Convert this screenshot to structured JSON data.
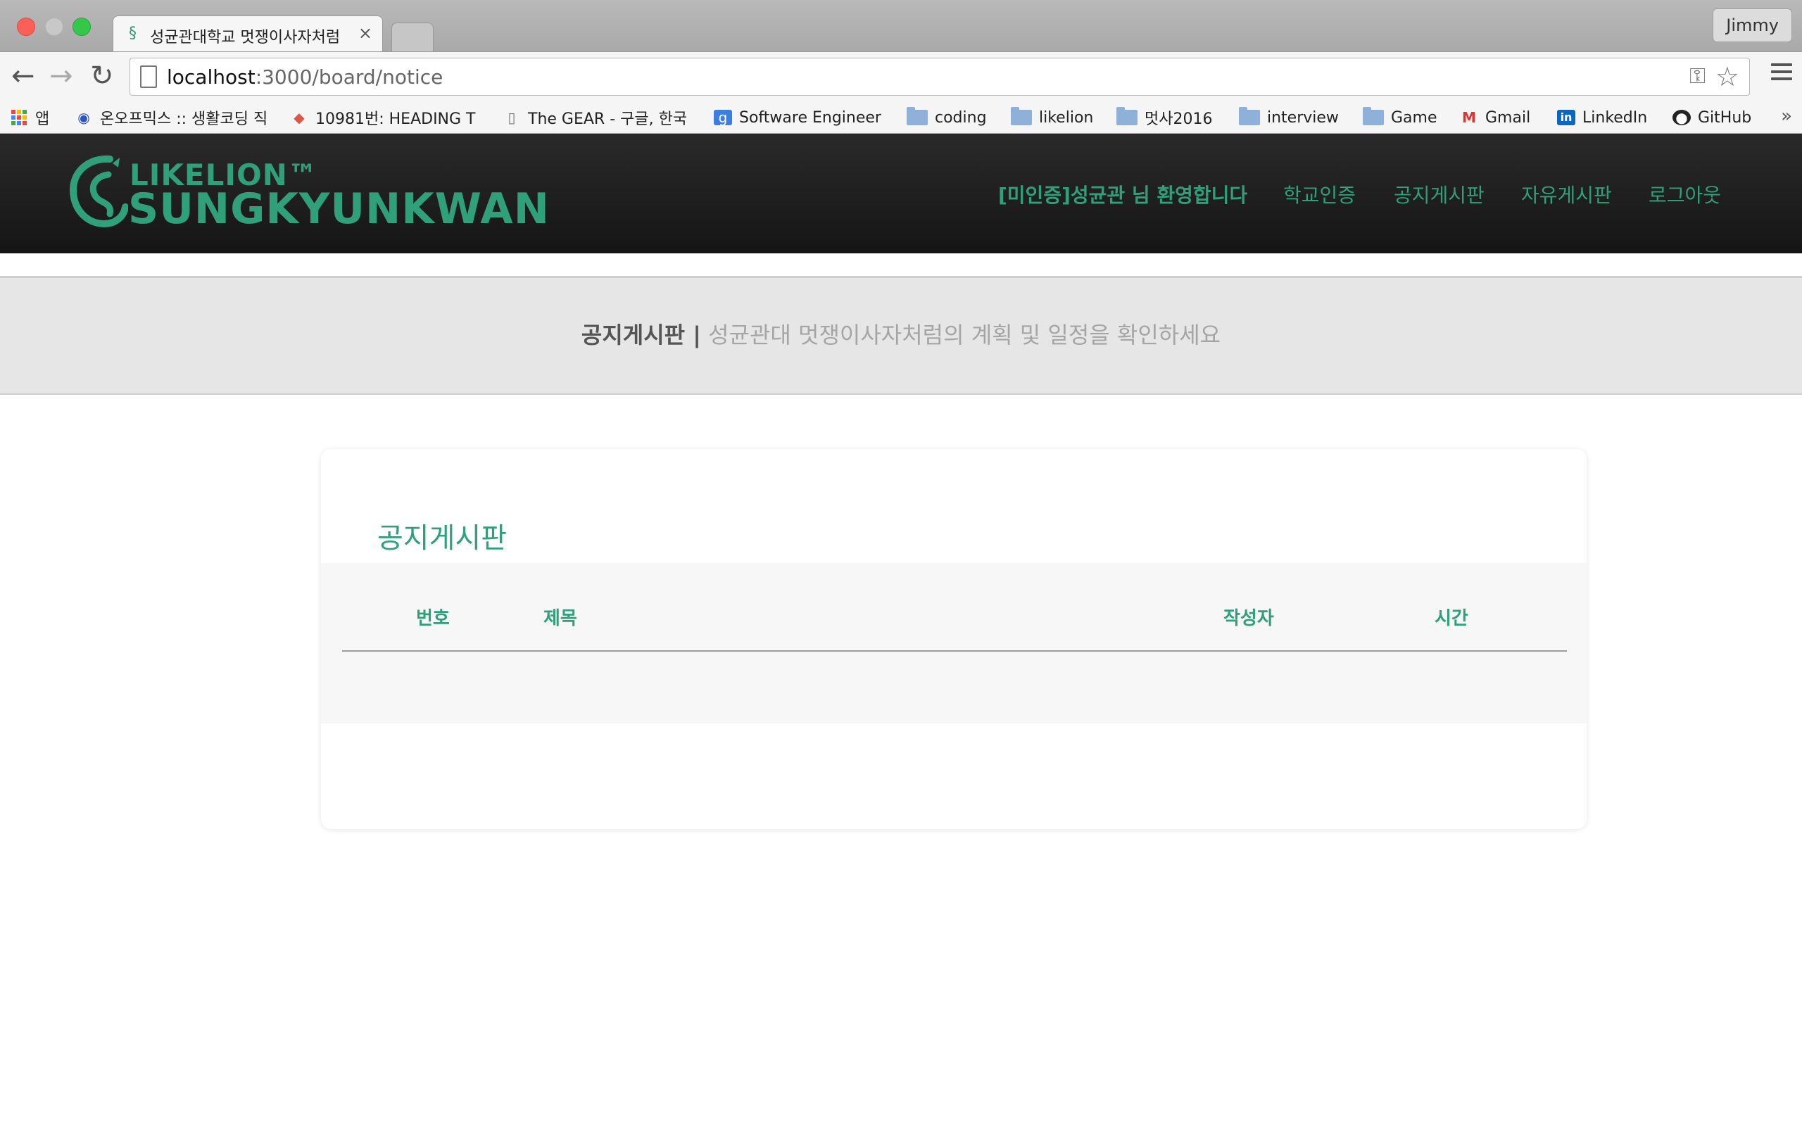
{
  "browser": {
    "tab_title": "성균관대학교 멋쟁이사자처럼",
    "tab_close": "×",
    "profile": "Jimmy",
    "url_host": "localhost",
    "url_path": ":3000/board/notice",
    "icons": {
      "back": "arrow-left-icon",
      "forward": "arrow-right-icon",
      "reload": "reload-icon",
      "key": "key-icon",
      "star": "star-icon",
      "menu": "hamburger-menu-icon"
    },
    "bookmarks": [
      {
        "label": "앱",
        "icon": "apps-grid-icon"
      },
      {
        "label": "온오프믹스 :: 생활코딩 직",
        "icon": "onoffmix-icon"
      },
      {
        "label": "10981번: HEADING T",
        "icon": "page-icon"
      },
      {
        "label": "The GEAR - 구글, 한국",
        "icon": "document-icon"
      },
      {
        "label": "Software Engineer",
        "icon": "google-icon"
      },
      {
        "label": "coding",
        "icon": "folder-icon"
      },
      {
        "label": "likelion",
        "icon": "folder-icon"
      },
      {
        "label": "멋사2016",
        "icon": "folder-icon"
      },
      {
        "label": "interview",
        "icon": "folder-icon"
      },
      {
        "label": "Game",
        "icon": "folder-icon"
      },
      {
        "label": "Gmail",
        "icon": "gmail-icon"
      },
      {
        "label": "LinkedIn",
        "icon": "linkedin-icon"
      },
      {
        "label": "GitHub",
        "icon": "github-icon"
      }
    ],
    "bookmarks_more": "»"
  },
  "site": {
    "logo_line1": "LIKELION™",
    "logo_line2": "SUNGKYUNKWAN",
    "welcome": "[미인증]성균관 님 환영합니다",
    "nav": [
      "학교인증",
      "공지게시판",
      "자유게시판",
      "로그아웃"
    ],
    "accent_color": "#2fa07a",
    "subheader": {
      "title": "공지게시판 |",
      "description": "성균관대 멋쟁이사자처럼의 계획 및 일정을 확인하세요"
    },
    "board": {
      "title": "공지게시판",
      "columns": [
        "번호",
        "제목",
        "작성자",
        "시간"
      ],
      "rows": []
    }
  }
}
